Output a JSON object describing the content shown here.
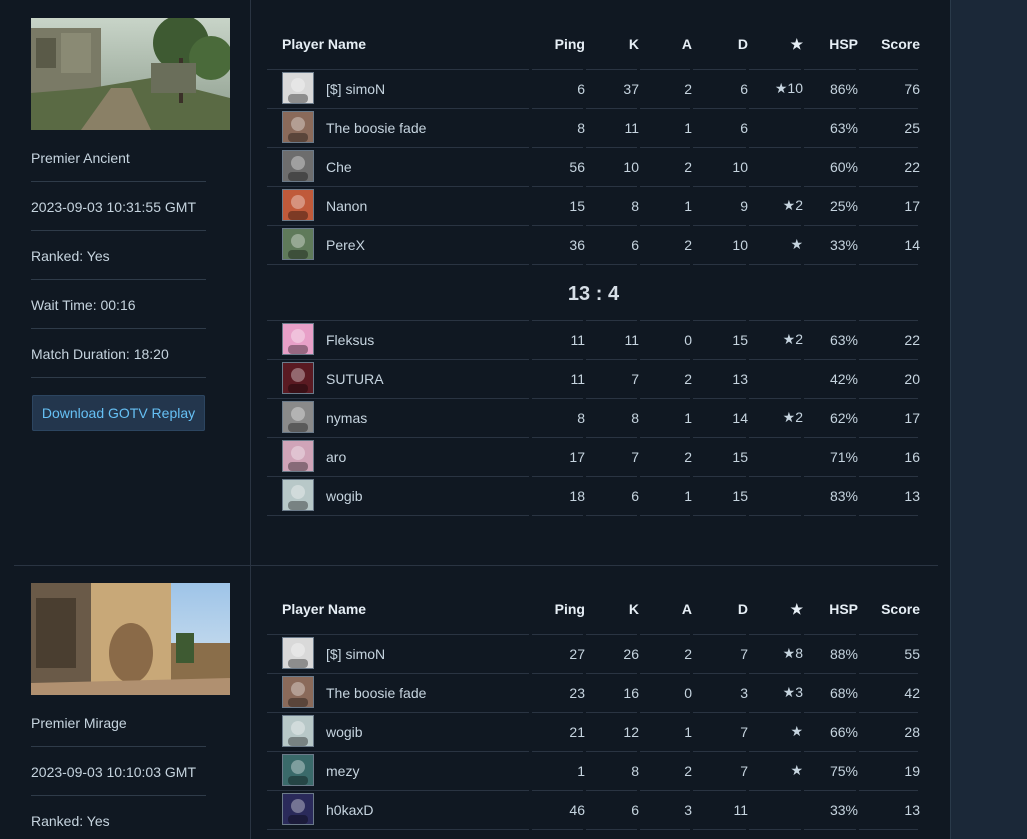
{
  "columns": {
    "player": "Player Name",
    "ping": "Ping",
    "k": "K",
    "a": "A",
    "d": "D",
    "mvp": "★",
    "hsp": "HSP",
    "score": "Score"
  },
  "matches": [
    {
      "map": "Premier Ancient",
      "date": "2023-09-03 10:31:55 GMT",
      "ranked": "Ranked: Yes",
      "wait": "Wait Time: 00:16",
      "duration": "Match Duration: 18:20",
      "download": "Download GOTV Replay",
      "score": "13 : 4",
      "team1": [
        {
          "name": "[$] simoN",
          "ping": "6",
          "k": "37",
          "a": "2",
          "d": "6",
          "mvp": "★10",
          "hsp": "86%",
          "score": "76",
          "avatar": "anime-girl-avatar",
          "color": "#d9d9d9"
        },
        {
          "name": "The boosie fade",
          "ping": "8",
          "k": "11",
          "a": "1",
          "d": "6",
          "mvp": "",
          "hsp": "63%",
          "score": "25",
          "avatar": "person-avatar",
          "color": "#8a6a5a"
        },
        {
          "name": "Che",
          "ping": "56",
          "k": "10",
          "a": "2",
          "d": "10",
          "mvp": "",
          "hsp": "60%",
          "score": "22",
          "avatar": "che-avatar",
          "color": "#6d6d6d"
        },
        {
          "name": "Nanon",
          "ping": "15",
          "k": "8",
          "a": "1",
          "d": "9",
          "mvp": "★2",
          "hsp": "25%",
          "score": "17",
          "avatar": "flowers-avatar",
          "color": "#c05a3a"
        },
        {
          "name": "PereX",
          "ping": "36",
          "k": "6",
          "a": "2",
          "d": "10",
          "mvp": "★",
          "hsp": "33%",
          "score": "14",
          "avatar": "pixel-face-avatar",
          "color": "#5f7a5a"
        }
      ],
      "team2": [
        {
          "name": "Fleksus",
          "ping": "11",
          "k": "11",
          "a": "0",
          "d": "15",
          "mvp": "★2",
          "hsp": "63%",
          "score": "22",
          "avatar": "toad-avatar",
          "color": "#e8a0c8"
        },
        {
          "name": "SUTURA",
          "ping": "11",
          "k": "7",
          "a": "2",
          "d": "13",
          "mvp": "",
          "hsp": "42%",
          "score": "20",
          "avatar": "dark-red-avatar",
          "color": "#5a1a22"
        },
        {
          "name": "nymas",
          "ping": "8",
          "k": "8",
          "a": "1",
          "d": "14",
          "mvp": "★2",
          "hsp": "62%",
          "score": "17",
          "avatar": "gray-avatar",
          "color": "#8a8a8a"
        },
        {
          "name": "aro",
          "ping": "17",
          "k": "7",
          "a": "2",
          "d": "15",
          "mvp": "",
          "hsp": "71%",
          "score": "16",
          "avatar": "pink-hair-avatar",
          "color": "#d0a4b8"
        },
        {
          "name": "wogib",
          "ping": "18",
          "k": "6",
          "a": "1",
          "d": "15",
          "mvp": "",
          "hsp": "83%",
          "score": "13",
          "avatar": "comic-face-avatar",
          "color": "#b8c8c8"
        }
      ]
    },
    {
      "map": "Premier Mirage",
      "date": "2023-09-03 10:10:03 GMT",
      "ranked": "Ranked: Yes",
      "team1": [
        {
          "name": "[$] simoN",
          "ping": "27",
          "k": "26",
          "a": "2",
          "d": "7",
          "mvp": "★8",
          "hsp": "88%",
          "score": "55",
          "avatar": "anime-girl-avatar",
          "color": "#d9d9d9"
        },
        {
          "name": "The boosie fade",
          "ping": "23",
          "k": "16",
          "a": "0",
          "d": "3",
          "mvp": "★3",
          "hsp": "68%",
          "score": "42",
          "avatar": "person-avatar",
          "color": "#8a6a5a"
        },
        {
          "name": "wogib",
          "ping": "21",
          "k": "12",
          "a": "1",
          "d": "7",
          "mvp": "★",
          "hsp": "66%",
          "score": "28",
          "avatar": "comic-face-avatar",
          "color": "#b8c8c8"
        },
        {
          "name": "mezy",
          "ping": "1",
          "k": "8",
          "a": "2",
          "d": "7",
          "mvp": "★",
          "hsp": "75%",
          "score": "19",
          "avatar": "teal-avatar",
          "color": "#3a6a6a"
        },
        {
          "name": "h0kaxD",
          "ping": "46",
          "k": "6",
          "a": "3",
          "d": "11",
          "mvp": "",
          "hsp": "33%",
          "score": "13",
          "avatar": "anime-dark-avatar",
          "color": "#2a2a5a"
        }
      ]
    }
  ]
}
